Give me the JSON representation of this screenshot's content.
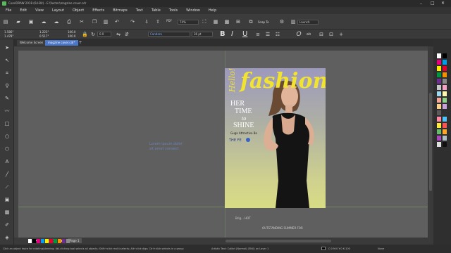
{
  "window": {
    "title": "CorelDRAW 2018 (64-Bit) - E:\\Vector\\magzine cover.cdr"
  },
  "menu": [
    "File",
    "Edit",
    "View",
    "Layout",
    "Object",
    "Effects",
    "Bitmaps",
    "Text",
    "Table",
    "Tools",
    "Window",
    "Help"
  ],
  "toolbar": {
    "zoom": "74%",
    "snap_label": "Snap To",
    "launch_label": "Launch"
  },
  "propbar": {
    "x": "1.586\"",
    "y": "1.478\"",
    "w": "1.223\"",
    "h": "0.517\"",
    "scale_w": "100.0",
    "scale_h": "100.0",
    "angle": "0.0",
    "font_name": "Candara",
    "font_size": "36 pt",
    "bold": "B",
    "italic": "I",
    "underline": "U"
  },
  "tabs": {
    "welcome": "Welcome Screen",
    "doc": "magzine cover.cdr*"
  },
  "canvas": {
    "placeholder_text": [
      "Lorem ipsum dolor",
      "sit amet consect"
    ]
  },
  "cover": {
    "hello": "Hello!",
    "fashion": "fashion",
    "her": "HER",
    "time": "TIME",
    "to": "to",
    "shine": "SHINE",
    "sub": "Guga Attractive Bo",
    "fe": "THE FE",
    "below1": "Brig... HOT",
    "below2": "OUTSTANDING SUMMER FOR"
  },
  "pages": {
    "page_label": "Page 1",
    "page_label2": "Page 1"
  },
  "status": {
    "hint": "Click an object twice for rotating/skewing; dbl-clicking tool selects all objects; Shift+click multi-selects; Alt+click digs; Ctrl+click selects in a group",
    "object": "Artistic Text: Calibri (Normal) (ENU) on Layer 1",
    "coords": "C:0 M:0 Y:0 K:100",
    "fill_label": "None"
  },
  "colors": {
    "fashion_yellow": "#f1e330",
    "palette": [
      "#ffffff",
      "#000000",
      "#e6007e",
      "#00a0e9",
      "#ffed00",
      "#e4002b",
      "#009640",
      "#f39200",
      "#6f2c91",
      "#8a8a8a",
      "#c8c8c8",
      "#f7a1c4",
      "#a0d8ef",
      "#fff9b0",
      "#f5a89a",
      "#8fd18b",
      "#ffd08a",
      "#c9a0dc",
      "#5a5a5a",
      "#303030",
      "#ff8ca6",
      "#4fc3f7",
      "#ffeb3b",
      "#ff5252",
      "#66bb6a",
      "#ffa726",
      "#ab47bc",
      "#b0bec5",
      "#e0e0e0",
      "#111111"
    ]
  }
}
